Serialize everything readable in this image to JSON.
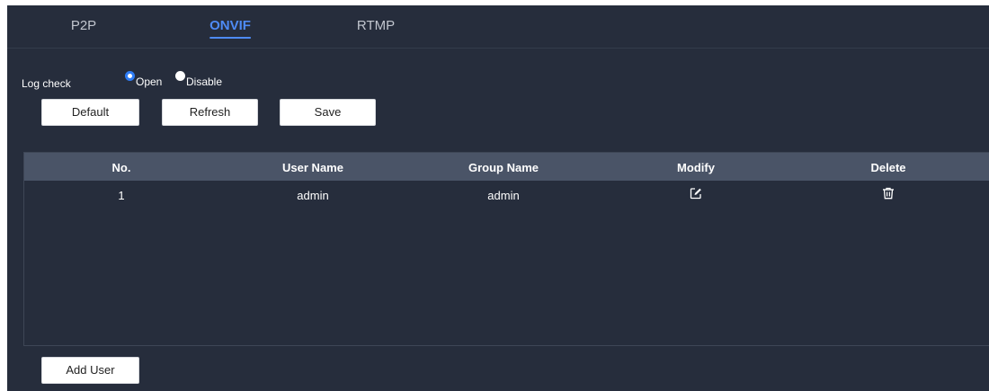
{
  "tabs": [
    {
      "label": "P2P",
      "active": false
    },
    {
      "label": "ONVIF",
      "active": true
    },
    {
      "label": "RTMP",
      "active": false
    }
  ],
  "log_check": {
    "label": "Log check",
    "options": [
      {
        "label": "Open",
        "checked": true
      },
      {
        "label": "Disable",
        "checked": false
      }
    ]
  },
  "buttons": {
    "default_label": "Default",
    "refresh_label": "Refresh",
    "save_label": "Save",
    "add_user_label": "Add User"
  },
  "table": {
    "headers": [
      "No.",
      "User Name",
      "Group Name",
      "Modify",
      "Delete"
    ],
    "rows": [
      {
        "no": "1",
        "user_name": "admin",
        "group_name": "admin",
        "modify_icon": "edit-icon",
        "delete_icon": "trash-icon"
      }
    ]
  },
  "colors": {
    "background": "#262d3c",
    "header": "#4a5467",
    "accent": "#4e8bf6"
  }
}
